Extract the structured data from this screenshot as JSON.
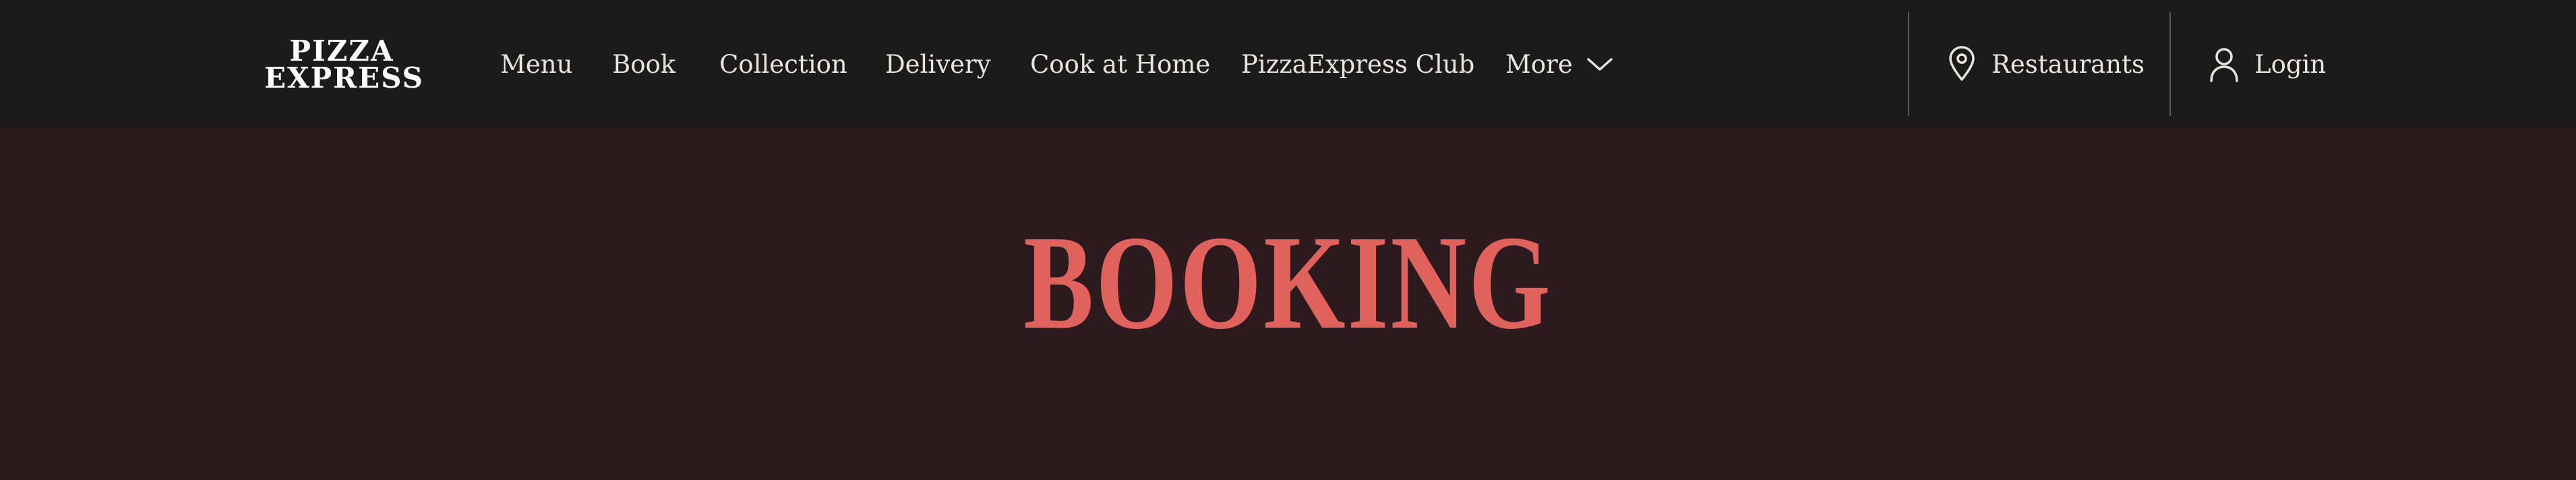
{
  "brand": {
    "logo_line1": "PIZZA",
    "logo_line2": "EXPRESS"
  },
  "nav": {
    "menu": "Menu",
    "book": "Book",
    "collection": "Collection",
    "delivery": "Delivery",
    "cook_at_home": "Cook at Home",
    "club": "PizzaExpress Club",
    "more": "More"
  },
  "utility": {
    "restaurants": "Restaurants",
    "login": "Login"
  },
  "hero": {
    "title": "BOOKING"
  },
  "colors": {
    "header_bg": "#1b1b1b",
    "page_bg": "#2d1a1e",
    "accent": "#e0625c",
    "nav_text": "#e9e5dc"
  },
  "icons": {
    "more": "chevron-down-icon",
    "restaurants": "location-pin-icon",
    "login": "user-icon"
  }
}
